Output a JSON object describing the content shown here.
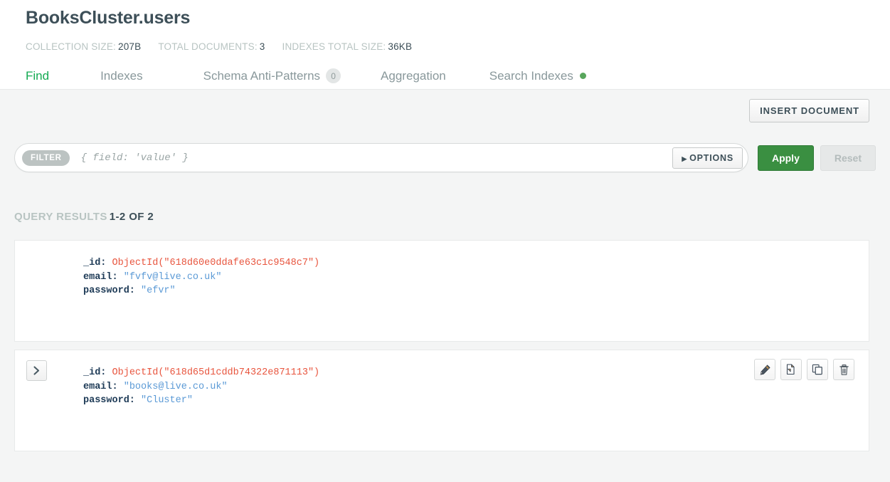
{
  "header": {
    "title": "BooksCluster.users",
    "meta": [
      {
        "label": "COLLECTION SIZE:",
        "value": "207B"
      },
      {
        "label": "TOTAL DOCUMENTS:",
        "value": "3"
      },
      {
        "label": "INDEXES TOTAL SIZE:",
        "value": "36KB"
      }
    ],
    "tabs": [
      {
        "label": "Find",
        "active": true
      },
      {
        "label": "Indexes",
        "active": false
      },
      {
        "label": "Schema Anti-Patterns",
        "badge": "0",
        "active": false
      },
      {
        "label": "Aggregation",
        "active": false
      },
      {
        "label": "Search Indexes",
        "dot": true,
        "active": false
      }
    ]
  },
  "toolbar": {
    "insert_label": "INSERT DOCUMENT",
    "options_label": "OPTIONS",
    "apply_label": "Apply",
    "reset_label": "Reset"
  },
  "filter": {
    "pill_label": "FILTER",
    "value": "",
    "placeholder": "{ field: 'value' }"
  },
  "results": {
    "label": "QUERY RESULTS",
    "count": "1-2 OF 2"
  },
  "documents": [
    {
      "expandable": false,
      "has_actions": false,
      "fields": [
        {
          "key": "_id:",
          "value": "ObjectId(\"618d60e0ddafe63c1c9548c7\")",
          "type": "objectid"
        },
        {
          "key": "email:",
          "value": "\"fvfv@live.co.uk\"",
          "type": "string"
        },
        {
          "key": "password:",
          "value": "\"efvr\"",
          "type": "string"
        }
      ]
    },
    {
      "expandable": true,
      "has_actions": true,
      "fields": [
        {
          "key": "_id:",
          "value": "ObjectId(\"618d65d1cddb74322e871113\")",
          "type": "objectid"
        },
        {
          "key": "email:",
          "value": "\"books@live.co.uk\"",
          "type": "string"
        },
        {
          "key": "password:",
          "value": "\"Cluster\"",
          "type": "string"
        }
      ]
    }
  ],
  "actions": {
    "edit": "edit-document",
    "clone": "clone-document",
    "copy": "copy-document",
    "delete": "delete-document"
  },
  "colors": {
    "accent_green": "#13aa52",
    "apply_green": "#3a8f41",
    "objectid_red": "#e8553e",
    "string_blue": "#5b9ad6",
    "dot_green": "#58a65c"
  }
}
